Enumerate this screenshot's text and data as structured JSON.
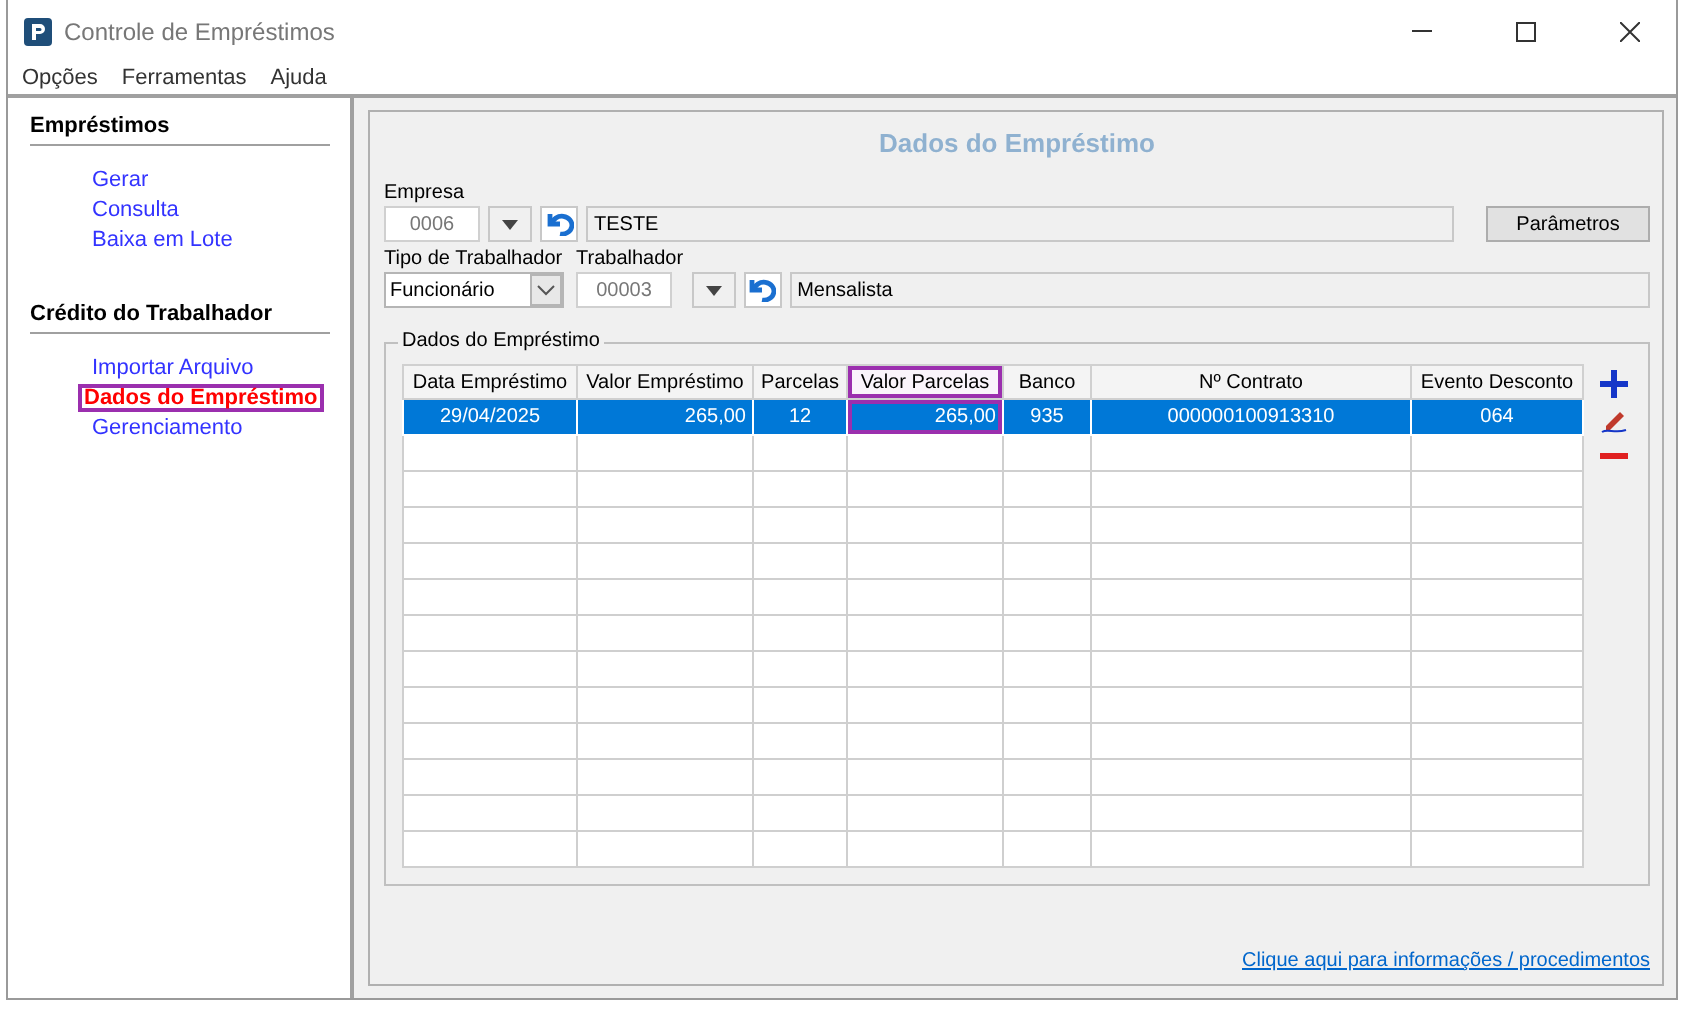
{
  "window": {
    "title": "Controle de Empréstimos"
  },
  "menu": [
    {
      "label": "Opções"
    },
    {
      "label": "Ferramentas"
    },
    {
      "label": "Ajuda"
    }
  ],
  "sidebar": [
    {
      "title": "Empréstimos",
      "items": [
        {
          "label": "Gerar",
          "selected": false,
          "highlighted": false
        },
        {
          "label": "Consulta",
          "selected": false,
          "highlighted": false
        },
        {
          "label": "Baixa em Lote",
          "selected": false,
          "highlighted": false
        }
      ]
    },
    {
      "title": "Crédito do Trabalhador",
      "items": [
        {
          "label": "Importar Arquivo",
          "selected": false,
          "highlighted": false
        },
        {
          "label": "Dados do Empréstimo",
          "selected": true,
          "highlighted": true
        },
        {
          "label": "Gerenciamento",
          "selected": false,
          "highlighted": false
        }
      ]
    }
  ],
  "panel": {
    "title": "Dados do Empréstimo",
    "empresa": {
      "label": "Empresa",
      "code": "0006",
      "name": "TESTE"
    },
    "parametros_button": "Parâmetros",
    "tipo": {
      "label": "Tipo de Trabalhador",
      "value": "Funcionário"
    },
    "trabalhador": {
      "label": "Trabalhador",
      "code": "00003",
      "name": "Mensalista"
    },
    "group": {
      "title": "Dados do Empréstimo",
      "columns": [
        {
          "label": "Data Empréstimo",
          "highlighted": false
        },
        {
          "label": "Valor Empréstimo",
          "highlighted": false
        },
        {
          "label": "Parcelas",
          "highlighted": false
        },
        {
          "label": "Valor Parcelas",
          "highlighted": true
        },
        {
          "label": "Banco",
          "highlighted": false
        },
        {
          "label": "Nº Contrato",
          "highlighted": false
        },
        {
          "label": "Evento Desconto",
          "highlighted": false
        }
      ],
      "rows": [
        {
          "selected": true,
          "cells": [
            "29/04/2025",
            "265,00",
            "12",
            "265,00",
            "935",
            "000000100913310",
            "064"
          ]
        }
      ]
    },
    "link": "Clique aqui para informações / procedimentos"
  }
}
